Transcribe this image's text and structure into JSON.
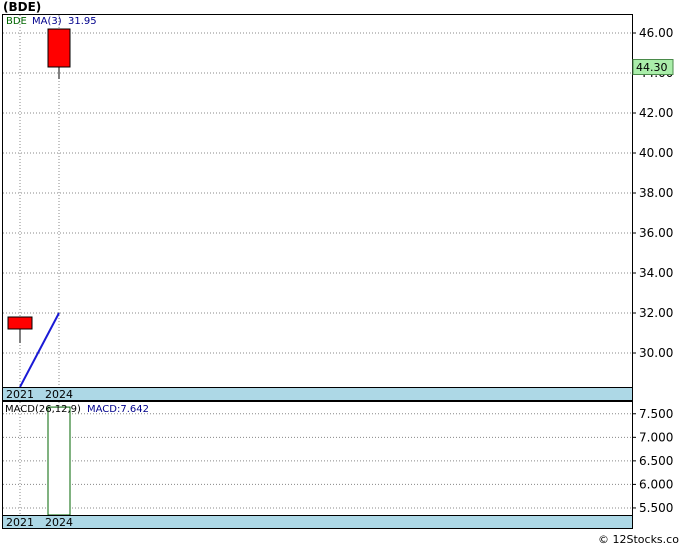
{
  "title": "(BDE)",
  "credit": "© 12Stocks.com",
  "colors": {
    "candle": "#ff0000",
    "ma_line": "#1a1ad6",
    "macd_bar_fill": "#ffffff",
    "macd_bar_stroke": "#006400",
    "axis_band": "#add8e6",
    "price_tag": "#aaeeaa",
    "grid": "#888888"
  },
  "chart_data": [
    {
      "type": "candlestick",
      "legend": {
        "symbol": "BDE",
        "ma_label": "MA(3)",
        "ma_value": "31.95"
      },
      "categories": [
        "2021",
        "2024"
      ],
      "candles": [
        {
          "x": "2021",
          "open": 31.8,
          "close": 31.2,
          "high": 31.8,
          "low": 30.5
        },
        {
          "x": "2024",
          "open": 46.2,
          "close": 44.3,
          "high": 46.2,
          "low": 43.7
        }
      ],
      "ma": [
        {
          "x": "2021",
          "y": 28.3
        },
        {
          "x": "2024",
          "y": 32.0
        }
      ],
      "last_price": "44.30",
      "last_value": 44.3,
      "yticks": [
        "30.00",
        "32.00",
        "34.00",
        "36.00",
        "38.00",
        "40.00",
        "42.00",
        "44.00",
        "46.00"
      ],
      "ylim": [
        28.3,
        46.9
      ],
      "grid": true
    },
    {
      "type": "bar",
      "legend": {
        "label": "MACD(26,12,9)",
        "value_label": "MACD:7.642"
      },
      "categories": [
        "2021",
        "2024"
      ],
      "values": [
        null,
        7.642
      ],
      "yticks": [
        "5.500",
        "6.000",
        "6.500",
        "7.000",
        "7.500"
      ],
      "ylim": [
        5.35,
        7.75
      ],
      "grid": true
    }
  ]
}
